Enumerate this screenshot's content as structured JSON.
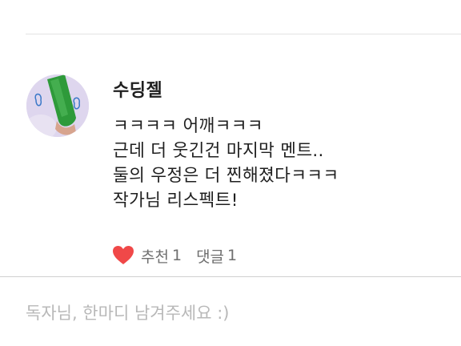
{
  "comment": {
    "author": "수딩젤",
    "lines": [
      "ㅋㅋㅋㅋ 어깨ㅋㅋㅋ",
      "근데 더 웃긴건 마지막 멘트..",
      "둘의 우정은 더 찐해졌다ㅋㅋㅋ",
      "작가님 리스펙트!"
    ],
    "like_label": "추천",
    "like_count": "1",
    "reply_label": "댓글",
    "reply_count": "1"
  },
  "composer": {
    "placeholder": "독자님, 한마디 남겨주세요 :)"
  },
  "colors": {
    "heart": "#f04848",
    "avatar_background": "#ded6ee",
    "avatar_tube": "#2e9a3a",
    "placeholder": "#b8b8b8"
  },
  "icons": {
    "like": "heart-icon"
  }
}
